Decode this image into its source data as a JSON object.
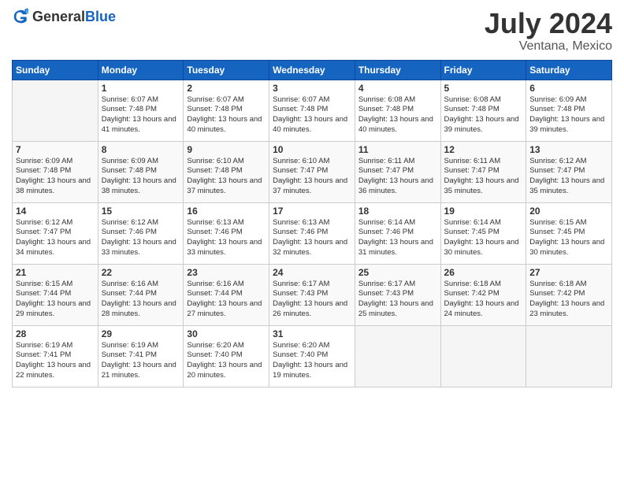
{
  "header": {
    "logo_general": "General",
    "logo_blue": "Blue",
    "month": "July 2024",
    "location": "Ventana, Mexico"
  },
  "days_of_week": [
    "Sunday",
    "Monday",
    "Tuesday",
    "Wednesday",
    "Thursday",
    "Friday",
    "Saturday"
  ],
  "weeks": [
    [
      {
        "day": "",
        "info": ""
      },
      {
        "day": "1",
        "info": "Sunrise: 6:07 AM\nSunset: 7:48 PM\nDaylight: 13 hours\nand 41 minutes."
      },
      {
        "day": "2",
        "info": "Sunrise: 6:07 AM\nSunset: 7:48 PM\nDaylight: 13 hours\nand 40 minutes."
      },
      {
        "day": "3",
        "info": "Sunrise: 6:07 AM\nSunset: 7:48 PM\nDaylight: 13 hours\nand 40 minutes."
      },
      {
        "day": "4",
        "info": "Sunrise: 6:08 AM\nSunset: 7:48 PM\nDaylight: 13 hours\nand 40 minutes."
      },
      {
        "day": "5",
        "info": "Sunrise: 6:08 AM\nSunset: 7:48 PM\nDaylight: 13 hours\nand 39 minutes."
      },
      {
        "day": "6",
        "info": "Sunrise: 6:09 AM\nSunset: 7:48 PM\nDaylight: 13 hours\nand 39 minutes."
      }
    ],
    [
      {
        "day": "7",
        "info": "Sunrise: 6:09 AM\nSunset: 7:48 PM\nDaylight: 13 hours\nand 38 minutes."
      },
      {
        "day": "8",
        "info": "Sunrise: 6:09 AM\nSunset: 7:48 PM\nDaylight: 13 hours\nand 38 minutes."
      },
      {
        "day": "9",
        "info": "Sunrise: 6:10 AM\nSunset: 7:48 PM\nDaylight: 13 hours\nand 37 minutes."
      },
      {
        "day": "10",
        "info": "Sunrise: 6:10 AM\nSunset: 7:47 PM\nDaylight: 13 hours\nand 37 minutes."
      },
      {
        "day": "11",
        "info": "Sunrise: 6:11 AM\nSunset: 7:47 PM\nDaylight: 13 hours\nand 36 minutes."
      },
      {
        "day": "12",
        "info": "Sunrise: 6:11 AM\nSunset: 7:47 PM\nDaylight: 13 hours\nand 35 minutes."
      },
      {
        "day": "13",
        "info": "Sunrise: 6:12 AM\nSunset: 7:47 PM\nDaylight: 13 hours\nand 35 minutes."
      }
    ],
    [
      {
        "day": "14",
        "info": "Sunrise: 6:12 AM\nSunset: 7:47 PM\nDaylight: 13 hours\nand 34 minutes."
      },
      {
        "day": "15",
        "info": "Sunrise: 6:12 AM\nSunset: 7:46 PM\nDaylight: 13 hours\nand 33 minutes."
      },
      {
        "day": "16",
        "info": "Sunrise: 6:13 AM\nSunset: 7:46 PM\nDaylight: 13 hours\nand 33 minutes."
      },
      {
        "day": "17",
        "info": "Sunrise: 6:13 AM\nSunset: 7:46 PM\nDaylight: 13 hours\nand 32 minutes."
      },
      {
        "day": "18",
        "info": "Sunrise: 6:14 AM\nSunset: 7:46 PM\nDaylight: 13 hours\nand 31 minutes."
      },
      {
        "day": "19",
        "info": "Sunrise: 6:14 AM\nSunset: 7:45 PM\nDaylight: 13 hours\nand 30 minutes."
      },
      {
        "day": "20",
        "info": "Sunrise: 6:15 AM\nSunset: 7:45 PM\nDaylight: 13 hours\nand 30 minutes."
      }
    ],
    [
      {
        "day": "21",
        "info": "Sunrise: 6:15 AM\nSunset: 7:44 PM\nDaylight: 13 hours\nand 29 minutes."
      },
      {
        "day": "22",
        "info": "Sunrise: 6:16 AM\nSunset: 7:44 PM\nDaylight: 13 hours\nand 28 minutes."
      },
      {
        "day": "23",
        "info": "Sunrise: 6:16 AM\nSunset: 7:44 PM\nDaylight: 13 hours\nand 27 minutes."
      },
      {
        "day": "24",
        "info": "Sunrise: 6:17 AM\nSunset: 7:43 PM\nDaylight: 13 hours\nand 26 minutes."
      },
      {
        "day": "25",
        "info": "Sunrise: 6:17 AM\nSunset: 7:43 PM\nDaylight: 13 hours\nand 25 minutes."
      },
      {
        "day": "26",
        "info": "Sunrise: 6:18 AM\nSunset: 7:42 PM\nDaylight: 13 hours\nand 24 minutes."
      },
      {
        "day": "27",
        "info": "Sunrise: 6:18 AM\nSunset: 7:42 PM\nDaylight: 13 hours\nand 23 minutes."
      }
    ],
    [
      {
        "day": "28",
        "info": "Sunrise: 6:19 AM\nSunset: 7:41 PM\nDaylight: 13 hours\nand 22 minutes."
      },
      {
        "day": "29",
        "info": "Sunrise: 6:19 AM\nSunset: 7:41 PM\nDaylight: 13 hours\nand 21 minutes."
      },
      {
        "day": "30",
        "info": "Sunrise: 6:20 AM\nSunset: 7:40 PM\nDaylight: 13 hours\nand 20 minutes."
      },
      {
        "day": "31",
        "info": "Sunrise: 6:20 AM\nSunset: 7:40 PM\nDaylight: 13 hours\nand 19 minutes."
      },
      {
        "day": "",
        "info": ""
      },
      {
        "day": "",
        "info": ""
      },
      {
        "day": "",
        "info": ""
      }
    ]
  ]
}
